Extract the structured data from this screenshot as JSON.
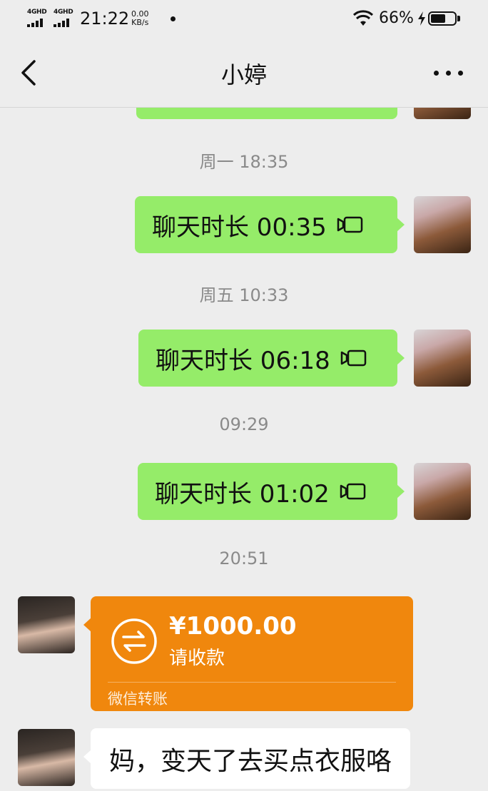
{
  "status_bar": {
    "signal1_label": "4GHD",
    "signal2_label": "4GHD",
    "time": "21:22",
    "speed_value": "0.00",
    "speed_unit": "KB/s",
    "battery_percent": "66%",
    "battery_level": 0.66
  },
  "header": {
    "title": "小婷",
    "back_icon": "chevron-left-icon",
    "more_icon": "more-dots-icon"
  },
  "messages": {
    "ts1": "周一 18:35",
    "call1_text": "聊天时长 00:35",
    "ts2": "周五 10:33",
    "call2_text": "聊天时长 06:18",
    "ts3": "09:29",
    "call3_text": "聊天时长 01:02",
    "ts4": "20:51",
    "transfer_amount": "¥1000.00",
    "transfer_desc": "请收款",
    "transfer_footer": "微信转账",
    "text_message": "妈，变天了去买点衣服咯"
  },
  "colors": {
    "background": "#ededed",
    "sent_bubble": "#95ec69",
    "transfer_bubble": "#f0870d",
    "received_bubble": "#ffffff"
  }
}
